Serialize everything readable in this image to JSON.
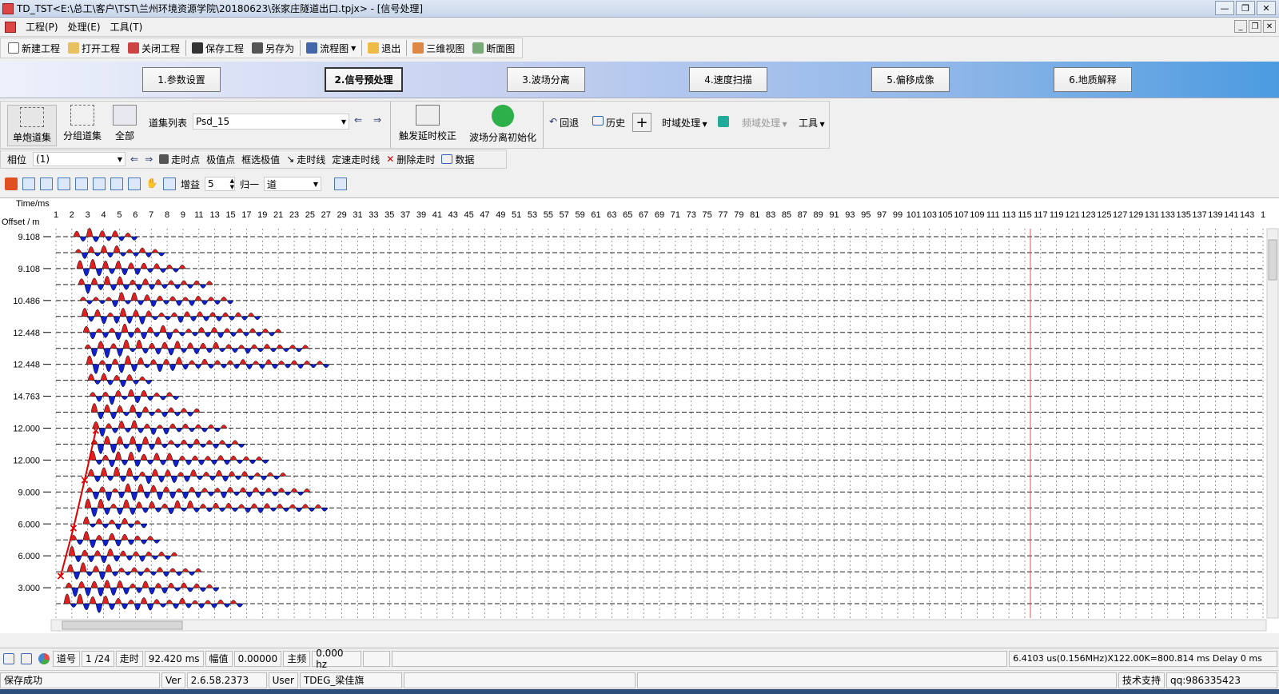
{
  "window": {
    "title": "TD_TST<E:\\总工\\客户\\TST\\兰州环境资源学院\\20180623\\张家庄隧道出口.tpjx> - [信号处理]"
  },
  "menu": [
    "工程(P)",
    "处理(E)",
    "工具(T)"
  ],
  "toolbar": {
    "new": "新建工程",
    "open": "打开工程",
    "close": "关闭工程",
    "save": "保存工程",
    "saveas": "另存为",
    "flow": "流程图",
    "exit": "退出",
    "view3d": "三维视图",
    "section": "断面图"
  },
  "steps": [
    "1.参数设置",
    "2.信号预处理",
    "3.波场分离",
    "4.速度扫描",
    "5.偏移成像",
    "6.地质解释"
  ],
  "panel": {
    "single": "单炮道集",
    "group": "分组道集",
    "all": "全部",
    "gather_label": "道集列表",
    "gather_value": "Psd_15",
    "trigger": "触发延时校正",
    "init": "波场分离初始化",
    "undo": "回退",
    "history": "历史",
    "time_proc": "时域处理",
    "freq_proc": "频域处理",
    "tools": "工具"
  },
  "row3": {
    "phase_label": "相位",
    "phase_value": "(1)",
    "pick": "走时点",
    "extreme": "极值点",
    "box_extreme": "框选极值",
    "tline": "走时线",
    "fixed_speed": "定速走时线",
    "delete": "删除走时",
    "data": "数据"
  },
  "row4": {
    "gain_label": "增益",
    "gain_value": "5",
    "norm_label": "归一",
    "norm_value": "道"
  },
  "plot": {
    "y_axis_title": "Time/ms",
    "y_label": "Offset / m",
    "x_ticks": [
      "1",
      "2",
      "3",
      "4",
      "5",
      "6",
      "7",
      "8",
      "9",
      "11",
      "13",
      "15",
      "17",
      "19",
      "21",
      "23",
      "25",
      "27",
      "29",
      "31",
      "33",
      "35",
      "37",
      "39",
      "41",
      "43",
      "45",
      "47",
      "49",
      "51",
      "53",
      "55",
      "57",
      "59",
      "61",
      "63",
      "65",
      "67",
      "69",
      "71",
      "73",
      "75",
      "77",
      "79",
      "81",
      "83",
      "85",
      "87",
      "89",
      "91",
      "93",
      "95",
      "97",
      "99",
      "101",
      "103",
      "105",
      "107",
      "109",
      "111",
      "113",
      "115",
      "117",
      "119",
      "121",
      "123",
      "125",
      "127",
      "129",
      "131",
      "133",
      "135",
      "137",
      "139",
      "141",
      "143",
      "1"
    ],
    "offsets": [
      "9.108",
      "9.108",
      "10.486",
      "12.448",
      "12.448",
      "14.763",
      "12.000",
      "12.000",
      "9.000",
      "6.000",
      "6.000",
      "3.000"
    ]
  },
  "status": {
    "trace_label": "道号",
    "trace_value": "1 /24",
    "time_label": "走时",
    "time_value": "92.420 ms",
    "amp_label": "幅值",
    "amp_value": "0.00000",
    "freq_label": "主频",
    "freq_value": "0.000 hz",
    "info": "6.4103 us(0.156MHz)X122.00K=800.814 ms Delay 0 ms"
  },
  "status2": {
    "msg": "保存成功",
    "ver_label": "Ver",
    "ver_value": "2.6.58.2373",
    "user_label": "User",
    "user_value": "TDEG_梁佳旗",
    "support": "技术支持",
    "qq": "qq:986335423"
  }
}
